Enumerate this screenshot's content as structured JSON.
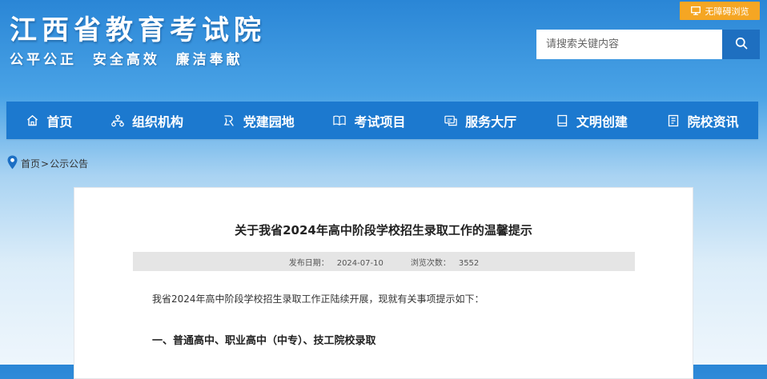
{
  "header": {
    "site_title": "江西省教育考试院",
    "slogan": "公平公正  安全高效  廉洁奉献",
    "accessibility_label": "无障碍浏览",
    "search": {
      "placeholder": "请搜索关键内容",
      "value": ""
    }
  },
  "nav": {
    "items": [
      {
        "label": "首页",
        "icon": "home-icon"
      },
      {
        "label": "组织机构",
        "icon": "org-chart-icon"
      },
      {
        "label": "党建园地",
        "icon": "party-icon"
      },
      {
        "label": "考试项目",
        "icon": "book-open-icon"
      },
      {
        "label": "服务大厅",
        "icon": "service-icon"
      },
      {
        "label": "文明创建",
        "icon": "book-icon"
      },
      {
        "label": "院校资讯",
        "icon": "document-icon"
      }
    ]
  },
  "breadcrumb": {
    "home": "首页",
    "separator": ">",
    "current": "公示公告"
  },
  "article": {
    "title": "关于我省2024年高中阶段学校招生录取工作的温馨提示",
    "publish_label": "发布日期：",
    "publish_date": "2024-07-10",
    "views_label": "浏览次数：",
    "views": "3552",
    "intro": "我省2024年高中阶段学校招生录取工作正陆续开展，现就有关事项提示如下：",
    "section_1": "一、普通高中、职业高中（中专）、技工院校录取"
  },
  "colors": {
    "nav_bg": "#1c79cf",
    "accessibility_bg": "#f5a623",
    "search_button_bg": "#1e6fc0",
    "location_pin": "#1c6fc4"
  }
}
